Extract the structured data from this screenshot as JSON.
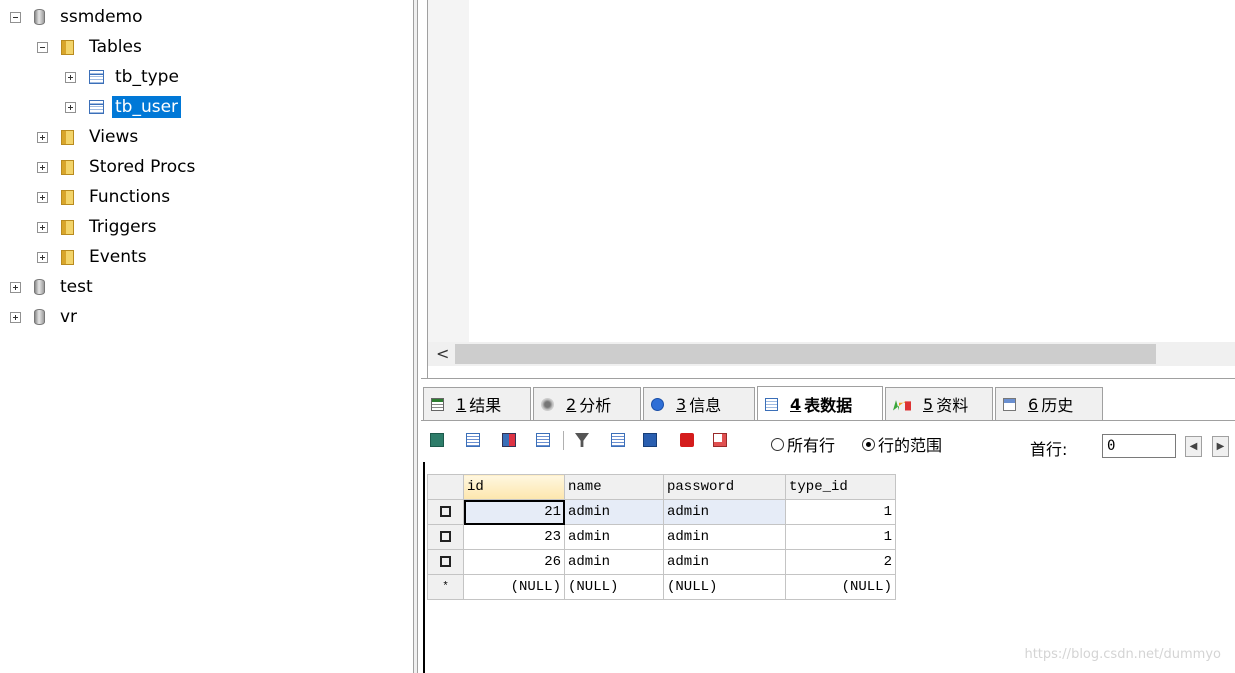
{
  "tree": {
    "databases": [
      {
        "name": "ssmdemo",
        "expanded": true
      },
      {
        "name": "test",
        "expanded": false
      },
      {
        "name": "vr",
        "expanded": false
      }
    ],
    "folders": {
      "tables": "Tables",
      "views": "Views",
      "stored_procs": "Stored Procs",
      "functions": "Functions",
      "triggers": "Triggers",
      "events": "Events"
    },
    "tables": [
      {
        "name": "tb_type",
        "selected": false
      },
      {
        "name": "tb_user",
        "selected": true
      }
    ]
  },
  "scrollbar": {
    "left_arrow": "<"
  },
  "tabs": [
    {
      "num": "1",
      "label": "结果",
      "active": false
    },
    {
      "num": "2",
      "label": "分析",
      "active": false
    },
    {
      "num": "3",
      "label": "信息",
      "active": false
    },
    {
      "num": "4",
      "label": "表数据",
      "active": true
    },
    {
      "num": "5",
      "label": "资料",
      "active": false
    },
    {
      "num": "6",
      "label": "历史",
      "active": false
    }
  ],
  "toolbar": {
    "radio_all_rows": "所有行",
    "radio_row_range": "行的范围",
    "radio_selected": "row_range",
    "first_row_label": "首行:",
    "first_row_value": "0",
    "prev": "◀",
    "next": "▶"
  },
  "grid": {
    "columns": [
      "id",
      "name",
      "password",
      "type_id"
    ],
    "rows": [
      [
        "21",
        "admin",
        "admin",
        "1"
      ],
      [
        "23",
        "admin",
        "admin",
        "1"
      ],
      [
        "26",
        "admin",
        "admin",
        "2"
      ]
    ],
    "new_row": [
      "(NULL)",
      "(NULL)",
      "(NULL)",
      "(NULL)"
    ],
    "new_row_marker": "*"
  },
  "watermark": "https://blog.csdn.net/dummyo"
}
